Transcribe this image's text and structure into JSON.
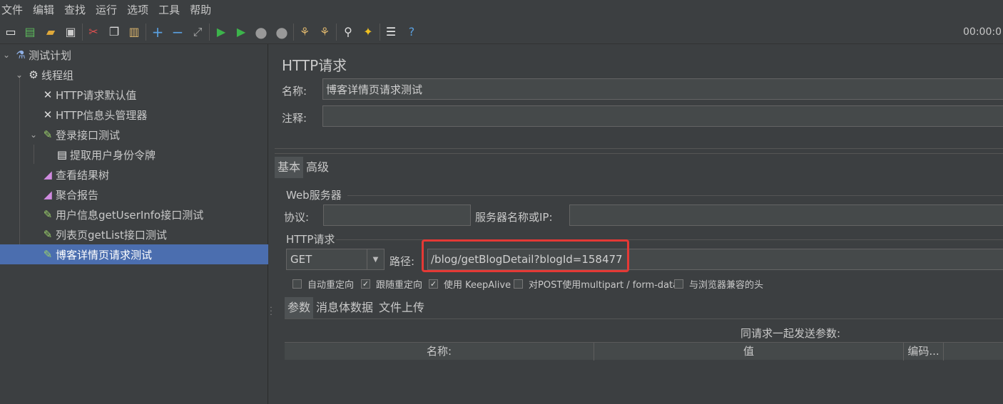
{
  "menu": [
    "文件",
    "编辑",
    "查找",
    "运行",
    "选项",
    "工具",
    "帮助"
  ],
  "toolbar": {
    "icons": [
      "new-icon",
      "templates-icon",
      "open-icon",
      "save-icon",
      "cut-icon",
      "copy-icon",
      "paste-icon",
      "expand-icon",
      "collapse-icon",
      "toggle-icon",
      "start-icon",
      "start-no-pause-icon",
      "stop-icon",
      "shutdown-icon",
      "clear-icon",
      "clear-all-icon",
      "search-icon",
      "reset-search-icon",
      "function-helper-icon",
      "help-icon"
    ],
    "timer": "00:00:0"
  },
  "tree": {
    "items": [
      {
        "label": "测试计划",
        "icon": "flask-icon"
      },
      {
        "label": "线程组",
        "icon": "gear-icon"
      },
      {
        "label": "HTTP请求默认值",
        "icon": "wrench-icon"
      },
      {
        "label": "HTTP信息头管理器",
        "icon": "wrench-icon"
      },
      {
        "label": "登录接口测试",
        "icon": "pen-icon"
      },
      {
        "label": "提取用户身份令牌",
        "icon": "document-icon"
      },
      {
        "label": "查看结果树",
        "icon": "chart-icon"
      },
      {
        "label": "聚合报告",
        "icon": "chart-icon"
      },
      {
        "label": "用户信息getUserInfo接口测试",
        "icon": "pen-icon"
      },
      {
        "label": "列表页getList接口测试",
        "icon": "pen-icon"
      },
      {
        "label": "博客详情页请求测试",
        "icon": "pen-icon"
      }
    ],
    "selected": "博客详情页请求测试"
  },
  "panel": {
    "title": "HTTP请求",
    "name_label": "名称:",
    "name_value": "博客详情页请求测试",
    "comment_label": "注释:",
    "comment_value": "",
    "tabs": [
      "基本",
      "高级"
    ],
    "web_server_group": "Web服务器",
    "protocol_label": "协议:",
    "protocol_value": "",
    "server_label": "服务器名称或IP:",
    "server_value": "",
    "http_group": "HTTP请求",
    "method": "GET",
    "path_label": "路径:",
    "path_value": "/blog/getBlogDetail?blogId=158477",
    "checkboxes": [
      {
        "label": "自动重定向",
        "checked": false
      },
      {
        "label": "跟随重定向",
        "checked": true
      },
      {
        "label": "使用 KeepAlive",
        "checked": true
      },
      {
        "label": "对POST使用multipart / form-data",
        "checked": false
      },
      {
        "label": "与浏览器兼容的头",
        "checked": false
      }
    ],
    "sub_tabs": [
      "参数",
      "消息体数据",
      "文件上传"
    ],
    "table_caption": "同请求一起发送参数:",
    "table_headers": [
      "名称:",
      "值",
      "编码..."
    ]
  },
  "colors": {
    "background": "#3c3f41",
    "selection": "#4b6eaf",
    "highlight_box": "#e53935"
  }
}
